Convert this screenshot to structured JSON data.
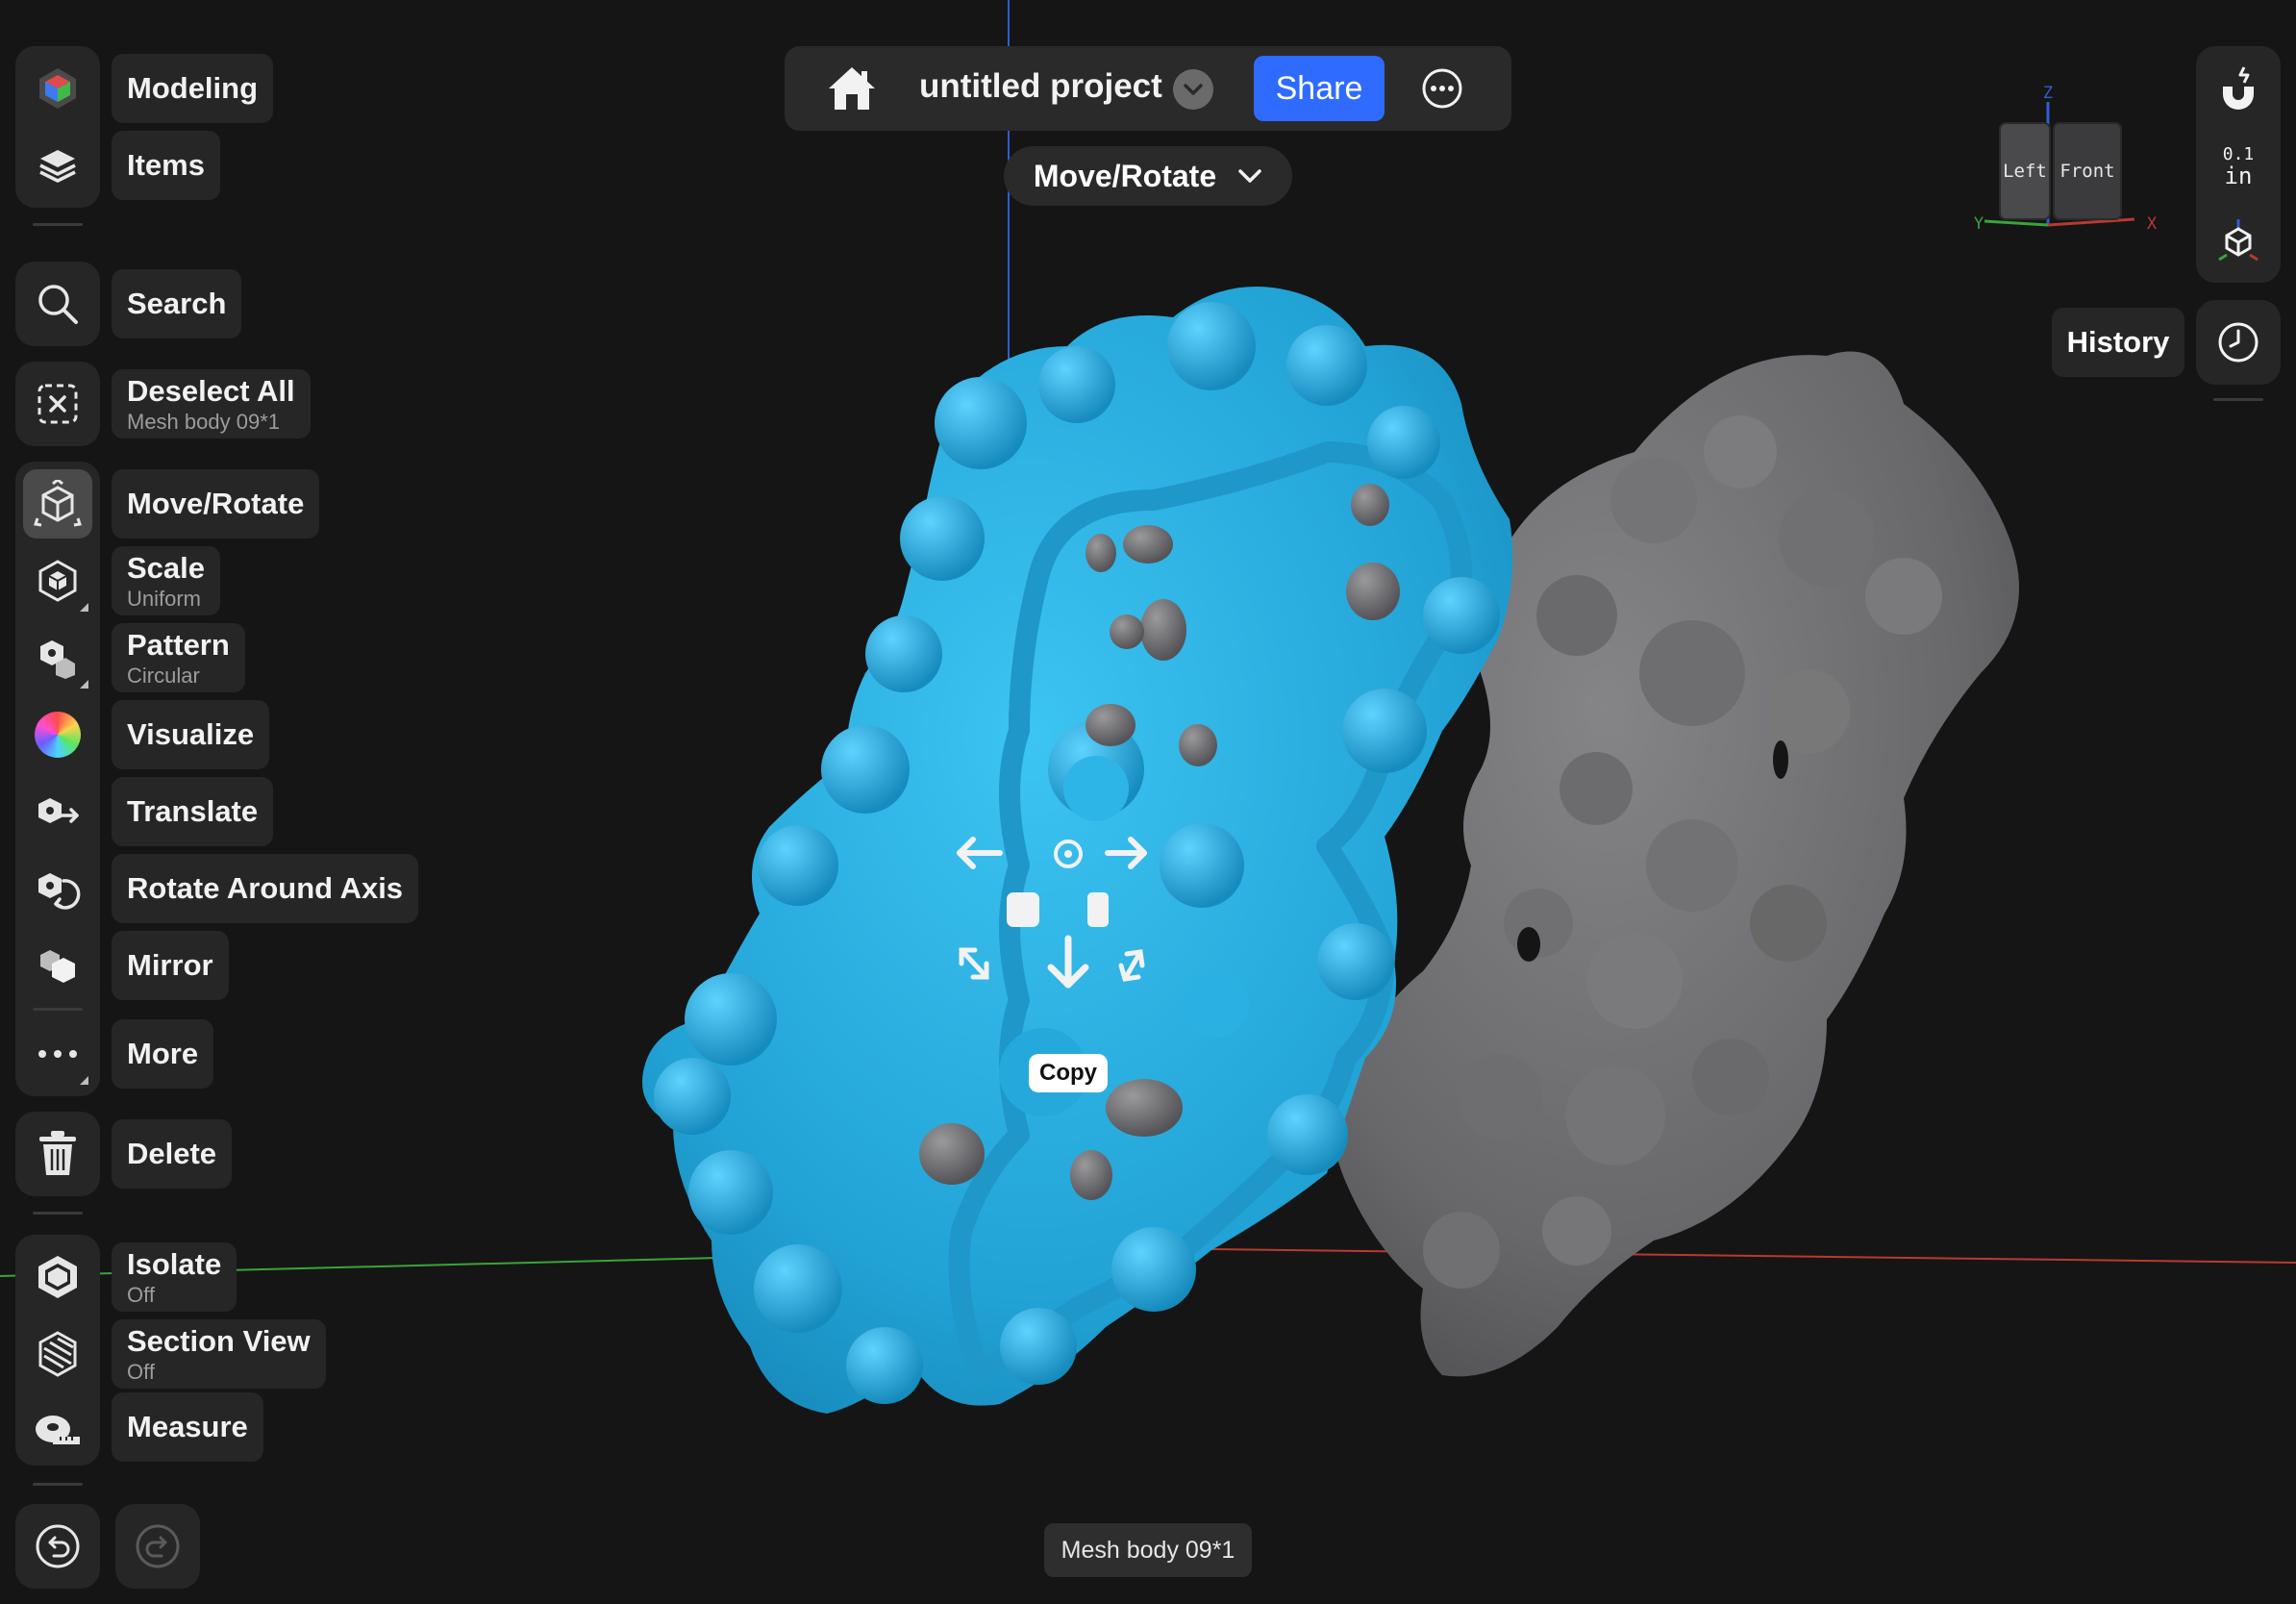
{
  "header": {
    "project_title": "untitled project",
    "share_label": "Share"
  },
  "mode_selector": {
    "label": "Move/Rotate"
  },
  "sidebar": {
    "items": [
      {
        "id": "modeling",
        "label": "Modeling",
        "sub": "",
        "icon": "app-logo-icon"
      },
      {
        "id": "items",
        "label": "Items",
        "sub": "",
        "icon": "layers-icon"
      },
      {
        "id": "search",
        "label": "Search",
        "sub": "",
        "icon": "search-icon"
      },
      {
        "id": "deselect-all",
        "label": "Deselect All",
        "sub": "Mesh body 09*1",
        "icon": "deselect-icon"
      },
      {
        "id": "move-rotate",
        "label": "Move/Rotate",
        "sub": "",
        "icon": "move-rotate-icon",
        "active": true
      },
      {
        "id": "scale",
        "label": "Scale",
        "sub": "Uniform",
        "icon": "scale-icon"
      },
      {
        "id": "pattern",
        "label": "Pattern",
        "sub": "Circular",
        "icon": "pattern-icon"
      },
      {
        "id": "visualize",
        "label": "Visualize",
        "sub": "",
        "icon": "color-wheel-icon"
      },
      {
        "id": "translate",
        "label": "Translate",
        "sub": "",
        "icon": "translate-icon"
      },
      {
        "id": "rotate-around-axis",
        "label": "Rotate Around Axis",
        "sub": "",
        "icon": "rotate-axis-icon"
      },
      {
        "id": "mirror",
        "label": "Mirror",
        "sub": "",
        "icon": "mirror-icon"
      },
      {
        "id": "more",
        "label": "More",
        "sub": "",
        "icon": "more-dots-icon"
      },
      {
        "id": "delete",
        "label": "Delete",
        "sub": "",
        "icon": "trash-icon"
      },
      {
        "id": "isolate",
        "label": "Isolate",
        "sub": "Off",
        "icon": "isolate-icon"
      },
      {
        "id": "section-view",
        "label": "Section View",
        "sub": "Off",
        "icon": "section-view-icon"
      },
      {
        "id": "measure",
        "label": "Measure",
        "sub": "",
        "icon": "tape-measure-icon"
      }
    ]
  },
  "right_panel": {
    "snap_value": "0.1",
    "snap_unit": "in",
    "history_label": "History"
  },
  "view_cube": {
    "left_face": "Left",
    "front_face": "Front",
    "axis_x": "X",
    "axis_y": "Y",
    "axis_z": "Z"
  },
  "gizmo": {
    "copy_label": "Copy"
  },
  "status": {
    "selection": "Mesh body 09*1"
  },
  "colors": {
    "background": "#151515",
    "panel": "#262626",
    "accent": "#2f6bff",
    "selected_mesh": "#2ba9db",
    "unselected_mesh": "#6e6e70",
    "axis_x": "#b63a32",
    "axis_y": "#3aa33a",
    "axis_z": "#2f5fcf"
  }
}
